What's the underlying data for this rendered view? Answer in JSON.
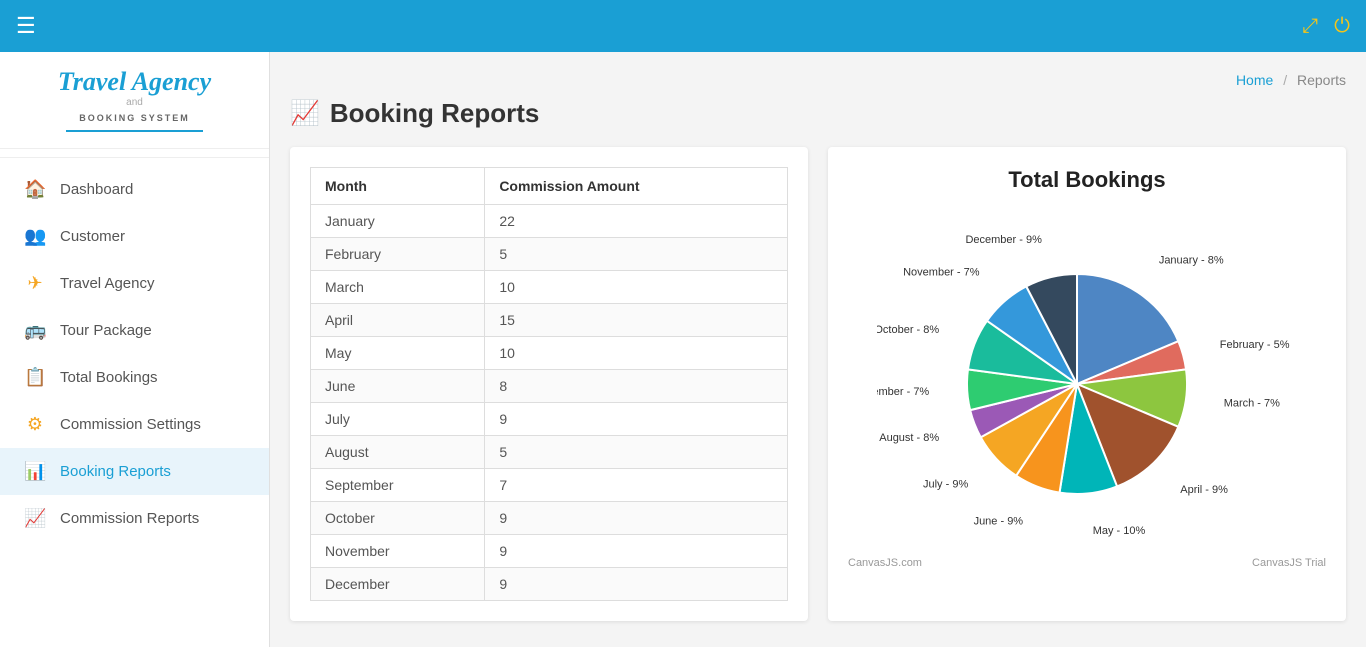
{
  "topbar": {
    "hamburger_label": "☰",
    "resize_icon": "⤢",
    "power_icon": "⏻"
  },
  "sidebar": {
    "logo": {
      "travel": "Travel Agency",
      "and": "and",
      "booking": "BOOKING SYSTEM"
    },
    "items": [
      {
        "id": "dashboard",
        "label": "Dashboard",
        "icon": "🏠"
      },
      {
        "id": "customer",
        "label": "Customer",
        "icon": "👥"
      },
      {
        "id": "travel-agency",
        "label": "Travel Agency",
        "icon": "✈"
      },
      {
        "id": "tour-package",
        "label": "Tour Package",
        "icon": "🚌"
      },
      {
        "id": "total-bookings",
        "label": "Total Bookings",
        "icon": "📋"
      },
      {
        "id": "commission-settings",
        "label": "Commission Settings",
        "icon": "⚙"
      },
      {
        "id": "booking-reports",
        "label": "Booking Reports",
        "icon": "📊",
        "active": true
      },
      {
        "id": "commission-reports",
        "label": "Commission Reports",
        "icon": "📈"
      }
    ]
  },
  "breadcrumb": {
    "home": "Home",
    "separator": "/",
    "current": "Reports"
  },
  "page_title": {
    "icon": "📈",
    "label": "Booking Reports"
  },
  "table": {
    "headers": [
      "Month",
      "Commission Amount"
    ],
    "rows": [
      {
        "month": "January",
        "amount": "22"
      },
      {
        "month": "February",
        "amount": "5"
      },
      {
        "month": "March",
        "amount": "10"
      },
      {
        "month": "April",
        "amount": "15"
      },
      {
        "month": "May",
        "amount": "10"
      },
      {
        "month": "June",
        "amount": "8"
      },
      {
        "month": "July",
        "amount": "9"
      },
      {
        "month": "August",
        "amount": "5"
      },
      {
        "month": "September",
        "amount": "7"
      },
      {
        "month": "October",
        "amount": "9"
      },
      {
        "month": "November",
        "amount": "9"
      },
      {
        "month": "December",
        "amount": "9"
      }
    ]
  },
  "chart": {
    "title": "Total Bookings",
    "footer_left": "CanvasJS.com",
    "footer_right": "CanvasJS Trial",
    "segments": [
      {
        "label": "January",
        "value": 22,
        "percent": 8,
        "color": "#4e86c4"
      },
      {
        "label": "February",
        "value": 5,
        "percent": 5,
        "color": "#e06b5e"
      },
      {
        "label": "March",
        "value": 10,
        "percent": 7,
        "color": "#8dc63f"
      },
      {
        "label": "April",
        "value": 15,
        "percent": 9,
        "color": "#a0522d"
      },
      {
        "label": "May",
        "value": 10,
        "percent": 10,
        "color": "#00b5b8"
      },
      {
        "label": "June",
        "value": 8,
        "percent": 9,
        "color": "#f7941d"
      },
      {
        "label": "July",
        "value": 9,
        "percent": 9,
        "color": "#f5a623"
      },
      {
        "label": "August",
        "value": 5,
        "percent": 8,
        "color": "#9b59b6"
      },
      {
        "label": "September",
        "value": 7,
        "percent": 7,
        "color": "#2ecc71"
      },
      {
        "label": "October",
        "value": 9,
        "percent": 8,
        "color": "#1abc9c"
      },
      {
        "label": "November",
        "value": 9,
        "percent": 7,
        "color": "#3498db"
      },
      {
        "label": "December",
        "value": 9,
        "percent": 9,
        "color": "#34495e"
      }
    ]
  }
}
